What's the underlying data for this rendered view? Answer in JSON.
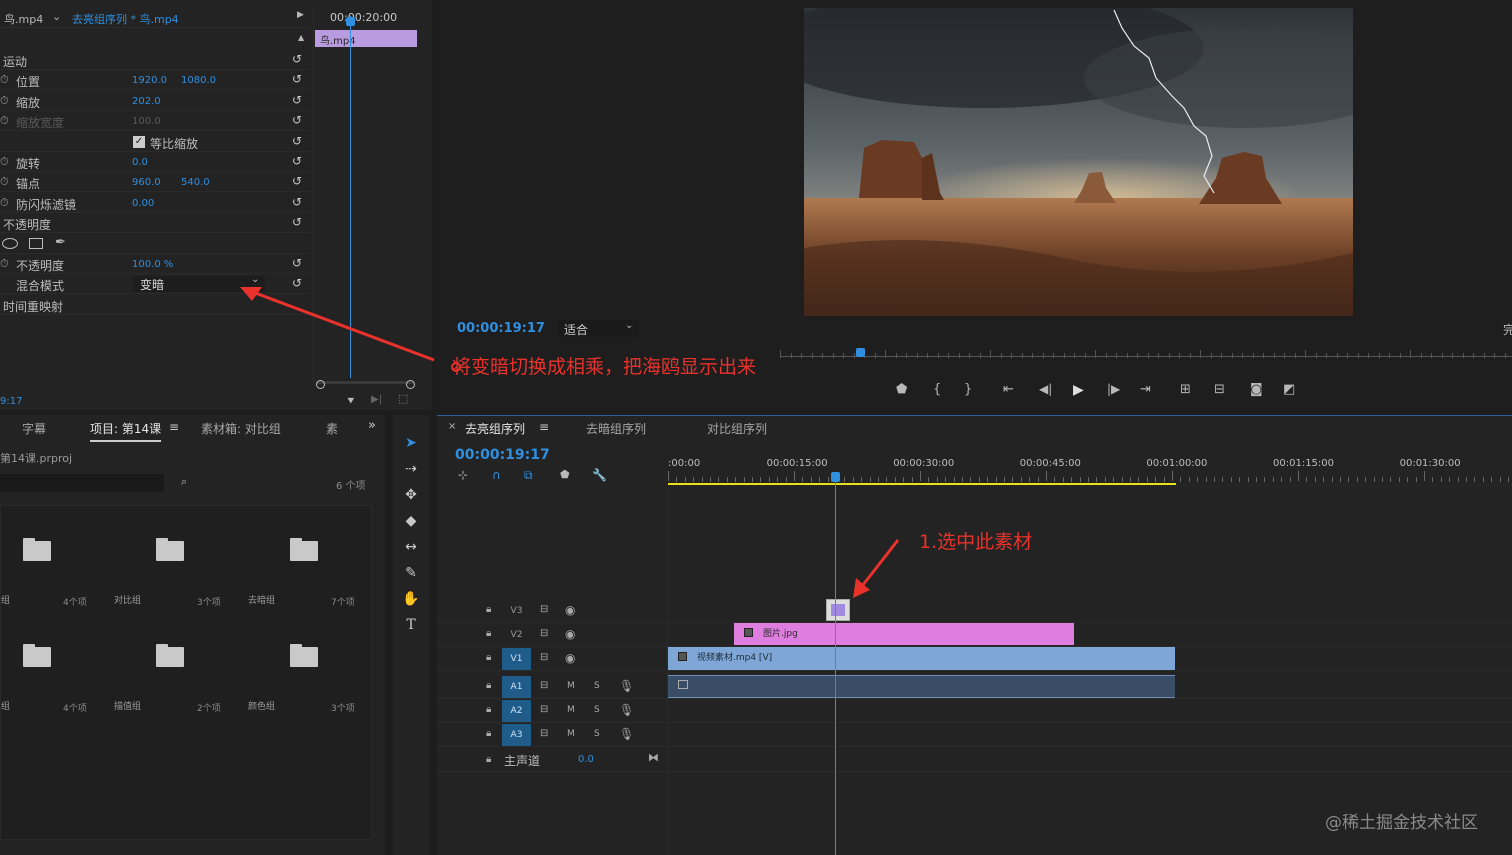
{
  "effect_controls": {
    "source_clip": "鸟.mp4",
    "sequence_clip": "去亮组序列 * 鸟.mp4",
    "timecode_header": "00:00:20:00",
    "mini_clip": "鸟.mp4",
    "current_time": "9:17",
    "rows": [
      {
        "label": "运动",
        "top": true
      },
      {
        "label": "位置",
        "v1": "1920.0",
        "v2": "1080.0"
      },
      {
        "label": "缩放",
        "v1": "202.0"
      },
      {
        "label": "缩放宽度",
        "v1": "100.0",
        "dim": true
      },
      {
        "label": "等比缩放",
        "checkbox": true
      },
      {
        "label": "旋转",
        "v1": "0.0"
      },
      {
        "label": "锚点",
        "v1": "960.0",
        "v2": "540.0"
      },
      {
        "label": "防闪烁滤镜",
        "v1": "0.00"
      },
      {
        "label": "不透明度",
        "top": true
      },
      {
        "label": "",
        "shapes": true
      },
      {
        "label": "不透明度",
        "v1": "100.0 %"
      },
      {
        "label": "混合模式",
        "dropdown": "变暗"
      },
      {
        "label": "时间重映射",
        "top": true
      }
    ]
  },
  "annotation_left": "将变暗切换成相乘，把海鸥显示出来",
  "annotation_right": "1.选中此素材",
  "program": {
    "timecode": "00:00:19:17",
    "fit": "适合",
    "right_edge": "完"
  },
  "project": {
    "tabs": [
      "字幕",
      "项目: 第14课",
      "素材箱: 对比组",
      "素"
    ],
    "file": "第14课.prproj",
    "item_count": "6 个项",
    "bins": [
      {
        "name": "组",
        "count": "4个项"
      },
      {
        "name": "对比组",
        "count": "3个项"
      },
      {
        "name": "去暗组",
        "count": "7个项"
      },
      {
        "name": "组",
        "count": "4个项"
      },
      {
        "name": "描值组",
        "count": "2个项"
      },
      {
        "name": "颜色组",
        "count": "3个项"
      }
    ]
  },
  "timeline": {
    "tabs": [
      "去亮组序列",
      "去暗组序列",
      "对比组序列"
    ],
    "timecode": "00:00:19:17",
    "ruler": [
      ":00:00",
      "00:00:15:00",
      "00:00:30:00",
      "00:00:45:00",
      "00:01:00:00",
      "00:01:15:00",
      "00:01:30:00"
    ],
    "tracks_video": [
      "V3",
      "V2",
      "V1"
    ],
    "tracks_audio": [
      "A1",
      "A2",
      "A3"
    ],
    "master": "主声道",
    "master_value": "0.0",
    "clip_image": "图片.jpg",
    "clip_video": "视频素材.mp4 [V]",
    "m_label": "M",
    "s_label": "S"
  },
  "watermark": "@稀土掘金技术社区",
  "colors": {
    "accent_blue": "#2f8fe0",
    "clip_pink": "#e07ee0",
    "clip_blue": "#7ea6d6",
    "annotation_red": "#e8322b",
    "work_area_yellow": "#e6e020"
  }
}
